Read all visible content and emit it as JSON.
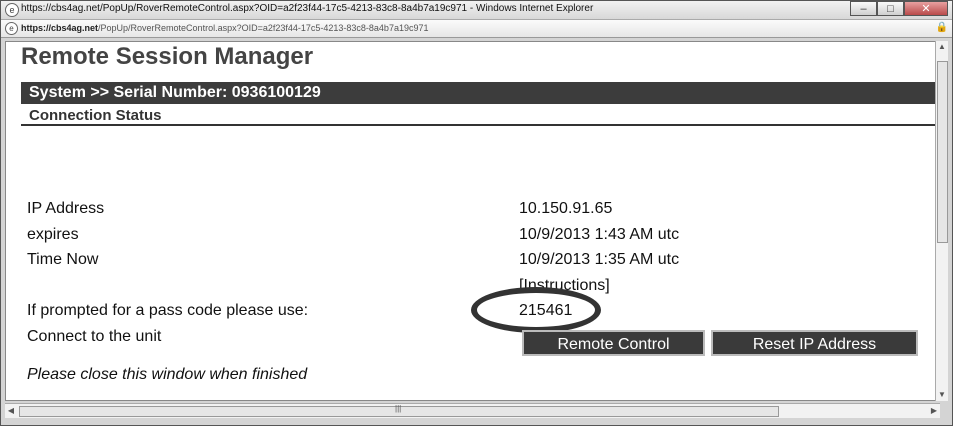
{
  "window": {
    "title": "https://cbs4ag.net/PopUp/RoverRemoteControl.aspx?OID=a2f23f44-17c5-4213-83c8-8a4b7a19c971 - Windows Internet Explorer"
  },
  "address": {
    "host": "https://cbs4ag.net",
    "path": "/PopUp/RoverRemoteControl.aspx?OID=a2f23f44-17c5-4213-83c8-8a4b7a19c971"
  },
  "page": {
    "heading": "Remote Session Manager",
    "system_bar": "System >> Serial Number: 0936100129",
    "section": "Connection Status",
    "rows": {
      "ip_label": "IP Address",
      "ip_value": "10.150.91.65",
      "expires_label": "expires",
      "expires_value": "10/9/2013 1:43 AM utc",
      "now_label": "Time Now",
      "now_value": "10/9/2013 1:35 AM utc",
      "instructions_link": "[Instructions]",
      "passcode_label": "If prompted for a pass code please use:",
      "passcode_value": "215461",
      "connect_label": "Connect to the unit"
    },
    "buttons": {
      "remote": "Remote Control",
      "reset": "Reset IP Address"
    },
    "footer": "Please close this window when finished"
  },
  "colors": {
    "bar": "#3c3c3c",
    "button": "#3a3a3a",
    "heading": "#444444"
  }
}
